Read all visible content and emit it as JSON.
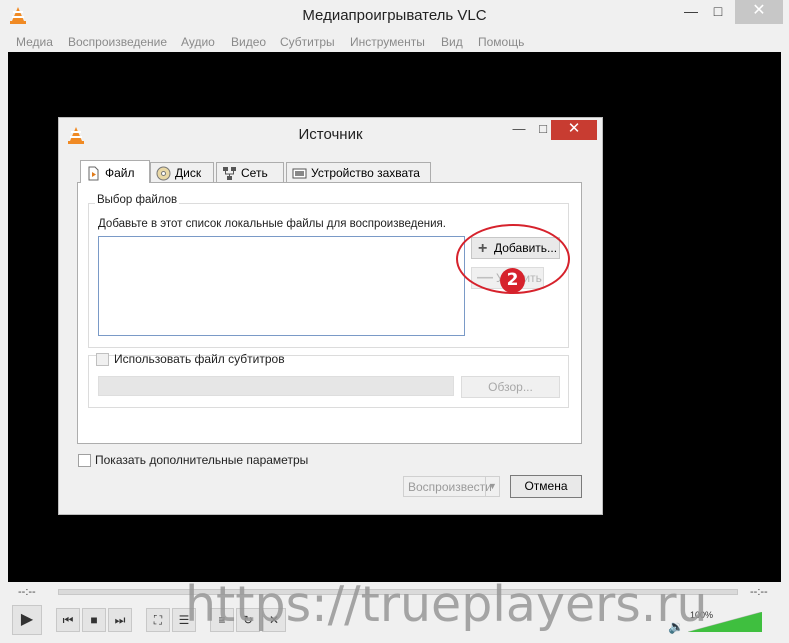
{
  "app": {
    "title": "Медиапроигрыватель VLC",
    "icon": "vlc-cone-icon",
    "window_controls": {
      "minimize": "—",
      "maximize": "□",
      "close": "✕"
    }
  },
  "menubar": [
    "Медиа",
    "Воспроизведение",
    "Аудио",
    "Видео",
    "Субтитры",
    "Инструменты",
    "Вид",
    "Помощь"
  ],
  "dialog": {
    "title": "Источник",
    "tabs": [
      {
        "label": "Файл",
        "icon": "file-icon",
        "active": true
      },
      {
        "label": "Диск",
        "icon": "disc-icon",
        "active": false
      },
      {
        "label": "Сеть",
        "icon": "network-icon",
        "active": false
      },
      {
        "label": "Устройство захвата",
        "icon": "capture-device-icon",
        "active": false
      }
    ],
    "file_group": {
      "label": "Выбор файлов",
      "hint": "Добавьте в этот список локальные файлы для воспроизведения.",
      "add_button": "Добавить...",
      "remove_button": "Удалить"
    },
    "annotation": {
      "badge": "2",
      "color": "#d6222c"
    },
    "subtitles": {
      "checkbox_label": "Использовать файл субтитров",
      "browse_button": "Обзор..."
    },
    "advanced_checkbox": "Показать дополнительные параметры",
    "play_button": "Воспроизвести",
    "play_dropdown_arrow": "▼",
    "cancel_button": "Отмена"
  },
  "player": {
    "time_elapsed": "--:--",
    "time_total": "--:--",
    "volume": "100%",
    "volume_level": 1.0
  },
  "watermark": "https://trueplayers.ru",
  "colors": {
    "close_active": "#c83c31",
    "accent_volume": "#3fbf3f",
    "video_bg": "#000000"
  }
}
